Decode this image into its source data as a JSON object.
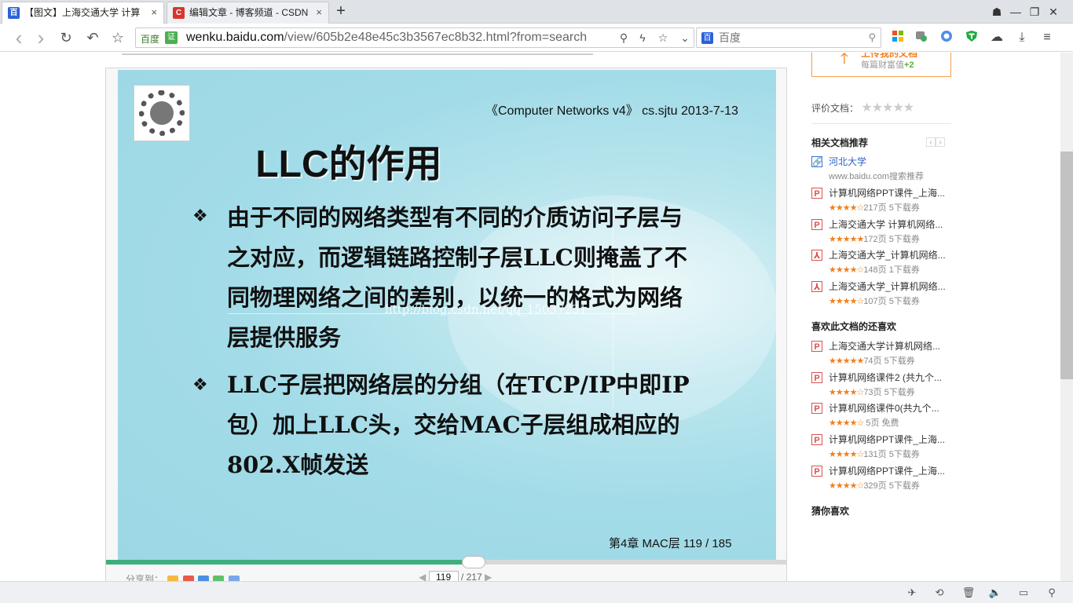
{
  "tabs": [
    {
      "title": "【图文】上海交通大学 计算",
      "fav": "百",
      "fav_color": "#2b62d9",
      "close": "×"
    },
    {
      "title": "编辑文章 - 博客频道 - CSDN",
      "fav": "C",
      "fav_color": "#d9362b",
      "close": "×"
    }
  ],
  "new_tab": "+",
  "window": {
    "pin": "☗",
    "minimize": "—",
    "restore": "❐",
    "close": "✕"
  },
  "nav": {
    "back": "‹",
    "forward": "›",
    "reload": "↻",
    "undo": "↶",
    "favorite": "☆"
  },
  "address": {
    "prefix": "百度",
    "cert": "证",
    "url_host": "wenku.baidu.com",
    "url_path": "/view/605b2e48e45c3b3567ec8b32.html?from=search",
    "zoom_icon": "⚲",
    "flash_icon": "ϟ",
    "star_icon": "☆",
    "dropdown_icon": "⌄"
  },
  "search": {
    "logo": "百",
    "placeholder": "百度",
    "icon": "⚲"
  },
  "doc_topcut": "——————————————————————————————————————————————————",
  "slide": {
    "header": "《Computer Networks v4》 cs.sjtu  2013-7-13",
    "title": "LLC的作用",
    "bullet_glyph": "❖",
    "bullets": [
      "由于不同的网络类型有不同的介质访问子层与之对应，而逻辑链路控制子层LLC则掩盖了不同物理网络之间的差别，以统一的格式为网络层提供服务",
      "LLC子层把网络层的分组（在TCP/IP中即IP包）加上LLC头，交给MAC子层组成相应的802.X帧发送"
    ],
    "watermark": "http://blog.csdn.net/qq_15037231",
    "footer": "第4章 MAC层 119 / 185"
  },
  "reader": {
    "progress": 0.54,
    "share_label": "分享到：",
    "share_colors": [
      "#f5b841",
      "#e9594b",
      "#4b8fe2",
      "#5ec06a",
      "#7aa7e8"
    ],
    "prev": "◀",
    "next": "▶",
    "current_page": "119",
    "total_pages": "/ 217"
  },
  "sidebar": {
    "upload_label": "上传我的文档",
    "upload_sub_prefix": "每篇财富值",
    "upload_sub_bonus": "+2",
    "rate_label": "评价文档：",
    "rate_stars": "★★★★★",
    "related_title": "相关文档推荐",
    "arrow_prev": "‹",
    "arrow_next": "›",
    "related": [
      {
        "icon": "🔗",
        "title": "河北大学",
        "meta": "www.baidu.com搜索推荐",
        "stars": ""
      },
      {
        "icon": "P",
        "title": "计算机网络PPT课件_上海...",
        "stars": "★★★★☆",
        "meta": "217页 5下载券"
      },
      {
        "icon": "P",
        "title": "上海交通大学 计算机网络...",
        "stars": "★★★★★",
        "meta": "172页 5下载券"
      },
      {
        "icon": "⅄",
        "title": "上海交通大学_计算机网络...",
        "stars": "★★★★☆",
        "meta": "148页 1下载券"
      },
      {
        "icon": "⅄",
        "title": "上海交通大学_计算机网络...",
        "stars": "★★★★☆",
        "meta": "107页 5下载券"
      }
    ],
    "also_title": "喜欢此文档的还喜欢",
    "also": [
      {
        "icon": "P",
        "title": "上海交通大学计算机网络...",
        "stars": "★★★★★",
        "meta": "74页  5下载券"
      },
      {
        "icon": "P",
        "title": "计算机网络课件2 (共九个...",
        "stars": "★★★★☆",
        "meta": "73页  5下载券"
      },
      {
        "icon": "P",
        "title": "计算机网络课件0(共九个...",
        "stars": "★★★★☆",
        "meta": " 5页   免费"
      },
      {
        "icon": "P",
        "title": "计算机网络PPT课件_上海...",
        "stars": "★★★★☆",
        "meta": "131页 5下载券"
      },
      {
        "icon": "P",
        "title": "计算机网络PPT课件_上海...",
        "stars": "★★★★☆",
        "meta": "329页 5下载券"
      }
    ],
    "guess_title": "猜你喜欢"
  },
  "status_icons": [
    "✈",
    "⟲",
    "🗑",
    "🔈",
    "▭",
    "⚲"
  ]
}
